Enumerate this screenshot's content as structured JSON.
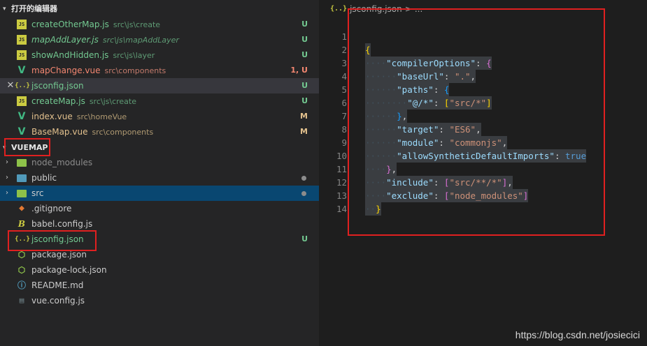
{
  "open_editors": {
    "title": "打开的编辑器",
    "items": [
      {
        "name": "createOtherMap.js",
        "path": "src\\js\\create",
        "status": "U"
      },
      {
        "name": "mapAddLayer.js",
        "path": "src\\js\\mapAddLayer",
        "status": "U"
      },
      {
        "name": "showAndHidden.js",
        "path": "src\\js\\layer",
        "status": "U"
      },
      {
        "name": "mapChange.vue",
        "path": "src\\components",
        "status": "1, U"
      },
      {
        "name": "jsconfig.json",
        "path": "",
        "status": "U"
      },
      {
        "name": "createMap.js",
        "path": "src\\js\\create",
        "status": "U"
      },
      {
        "name": "index.vue",
        "path": "src\\homeVue",
        "status": "M"
      },
      {
        "name": "BaseMap.vue",
        "path": "src\\components",
        "status": "M"
      }
    ]
  },
  "explorer": {
    "title": "VUEMAP",
    "items": [
      {
        "name": "node_modules",
        "status": ""
      },
      {
        "name": "public",
        "status": ""
      },
      {
        "name": "src",
        "status": ""
      },
      {
        "name": ".gitignore",
        "status": ""
      },
      {
        "name": "babel.config.js",
        "status": ""
      },
      {
        "name": "jsconfig.json",
        "status": "U"
      },
      {
        "name": "package.json",
        "status": ""
      },
      {
        "name": "package-lock.json",
        "status": ""
      },
      {
        "name": "README.md",
        "status": ""
      },
      {
        "name": "vue.config.js",
        "status": ""
      }
    ]
  },
  "editor": {
    "breadcrumb_icon": "{..}",
    "breadcrumb_file": "jsconfig.json",
    "breadcrumb_sep": ">",
    "breadcrumb_more": "...",
    "line_numbers": [
      "1",
      "2",
      "3",
      "4",
      "5",
      "6",
      "7",
      "8",
      "9",
      "10",
      "11",
      "12",
      "13",
      "14"
    ],
    "code": {
      "compilerOptions": "\"compilerOptions\"",
      "baseUrl": "\"baseUrl\"",
      "baseUrl_val": "\".\"",
      "paths": "\"paths\"",
      "alias": "\"@/*\"",
      "alias_val": "\"src/*\"",
      "target": "\"target\"",
      "target_val": "\"ES6\"",
      "module": "\"module\"",
      "module_val": "\"commonjs\"",
      "allowSynthetic": "\"allowSyntheticDefaultImports\"",
      "allowSynthetic_val": "true",
      "include": "\"include\"",
      "include_val": "\"src/**/*\"",
      "exclude": "\"exclude\"",
      "exclude_val": "\"node_modules\""
    }
  },
  "watermark": "https://blog.csdn.net/josiecici",
  "colors": {
    "untracked": "#73c991",
    "modified": "#e2c08d",
    "annotation": "#e02020"
  }
}
